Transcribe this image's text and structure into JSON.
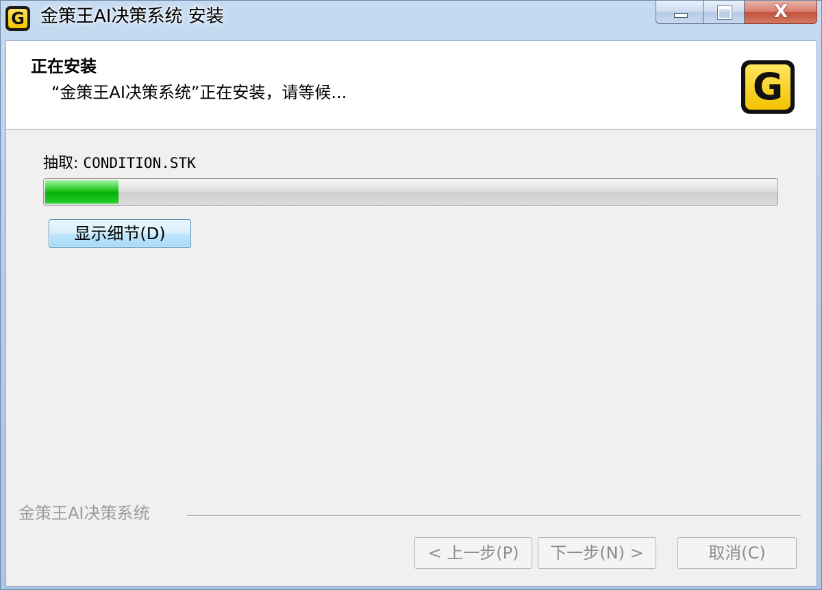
{
  "window": {
    "title": "金策王AI决策系统 安装",
    "icon": "app-logo-g",
    "logo_letter": "G",
    "caption": {
      "minimize_icon": "minimize-icon",
      "maximize_icon": "maximize-icon",
      "close_glyph": "X"
    }
  },
  "header": {
    "title": "正在安装",
    "subtitle": "“金策王AI决策系统”正在安装，请等候...",
    "logo_letter": "G"
  },
  "main": {
    "extract_label": "抽取:",
    "extract_file": "CONDITION.STK",
    "progress_fraction": 0.1,
    "progress_color": "#07b007",
    "details_button": "显示细节(D)"
  },
  "footer": {
    "brand": "金策王AI决策系统",
    "back_button": "< 上一步(P)",
    "next_button": "下一步(N) >",
    "cancel_button": "取消(C)",
    "disabled_text_color": "#8d8d8d"
  }
}
